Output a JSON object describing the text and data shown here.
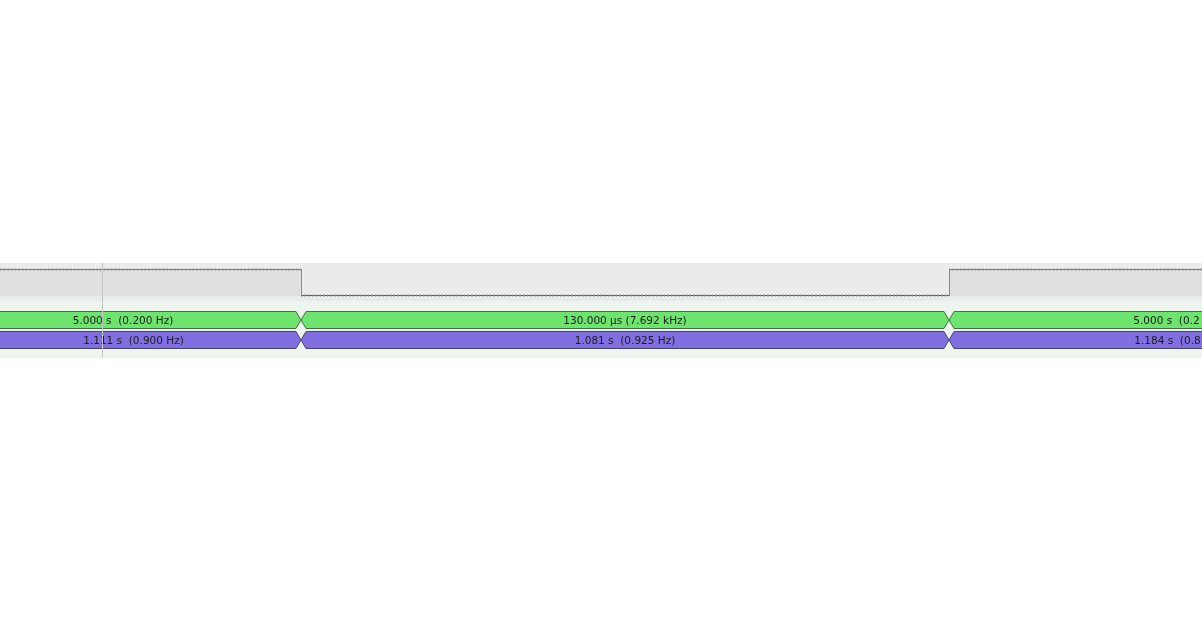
{
  "annotation_rows": [
    {
      "color": "#6de46d",
      "segments": [
        {
          "label": "5.000 s  (0.200 Hz)"
        },
        {
          "label": "130.000 µs (7.692 kHz)"
        },
        {
          "label": "5.000 s  (0.2"
        }
      ]
    },
    {
      "color": "#816fe2",
      "segments": [
        {
          "label": "1.111 s  (0.900 Hz)"
        },
        {
          "label": "1.081 s  (0.925 Hz)"
        },
        {
          "label": "1.184 s  (0.8"
        }
      ]
    }
  ]
}
